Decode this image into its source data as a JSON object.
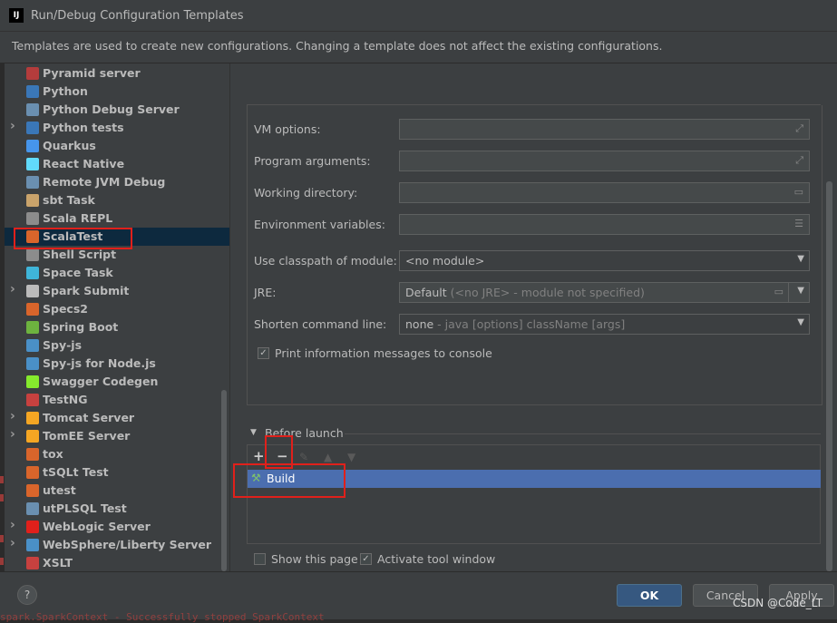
{
  "window": {
    "title": "Run/Debug Configuration Templates",
    "icon_label": "IJ"
  },
  "banner": {
    "text": "Templates are used to create new configurations. Changing a template does not affect the existing configurations."
  },
  "tree": {
    "items": [
      {
        "label": "Pyramid server",
        "icon": "pyramid-icon",
        "color": "#b43c3c",
        "expandable": false,
        "selected": false
      },
      {
        "label": "Python",
        "icon": "python-icon",
        "color": "#3a77b8",
        "expandable": false,
        "selected": false
      },
      {
        "label": "Python Debug Server",
        "icon": "python-debug-icon",
        "color": "#6a8fb0",
        "expandable": false,
        "selected": false
      },
      {
        "label": "Python tests",
        "icon": "python-tests-icon",
        "color": "#3a77b8",
        "expandable": true,
        "selected": false
      },
      {
        "label": "Quarkus",
        "icon": "quarkus-icon",
        "color": "#4695eb",
        "expandable": false,
        "selected": false
      },
      {
        "label": "React Native",
        "icon": "react-icon",
        "color": "#61dafb",
        "expandable": false,
        "selected": false
      },
      {
        "label": "Remote JVM Debug",
        "icon": "remote-debug-icon",
        "color": "#6a8fb0",
        "expandable": false,
        "selected": false
      },
      {
        "label": "sbt Task",
        "icon": "sbt-icon",
        "color": "#c9a36b",
        "expandable": false,
        "selected": false
      },
      {
        "label": "Scala REPL",
        "icon": "scala-repl-icon",
        "color": "#8c8c8c",
        "expandable": false,
        "selected": false
      },
      {
        "label": "ScalaTest",
        "icon": "scalatest-icon",
        "color": "#d9652b",
        "expandable": false,
        "selected": true
      },
      {
        "label": "Shell Script",
        "icon": "shell-script-icon",
        "color": "#8c8c8c",
        "expandable": false,
        "selected": false
      },
      {
        "label": "Space Task",
        "icon": "space-icon",
        "color": "#3fb5d9",
        "expandable": false,
        "selected": false
      },
      {
        "label": "Spark Submit",
        "icon": "spark-icon",
        "color": "#bbbbbb",
        "expandable": true,
        "selected": false
      },
      {
        "label": "Specs2",
        "icon": "specs2-icon",
        "color": "#d9652b",
        "expandable": false,
        "selected": false
      },
      {
        "label": "Spring Boot",
        "icon": "spring-boot-icon",
        "color": "#6db33f",
        "expandable": false,
        "selected": false
      },
      {
        "label": "Spy-js",
        "icon": "spyjs-icon",
        "color": "#4a90c7",
        "expandable": false,
        "selected": false
      },
      {
        "label": "Spy-js for Node.js",
        "icon": "spyjs-node-icon",
        "color": "#4a90c7",
        "expandable": false,
        "selected": false
      },
      {
        "label": "Swagger Codegen",
        "icon": "swagger-icon",
        "color": "#85ea2d",
        "expandable": false,
        "selected": false
      },
      {
        "label": "TestNG",
        "icon": "testng-icon",
        "color": "#c7413f",
        "expandable": false,
        "selected": false
      },
      {
        "label": "Tomcat Server",
        "icon": "tomcat-icon",
        "color": "#f5a623",
        "expandable": true,
        "selected": false
      },
      {
        "label": "TomEE Server",
        "icon": "tomee-icon",
        "color": "#f5a623",
        "expandable": true,
        "selected": false
      },
      {
        "label": "tox",
        "icon": "tox-icon",
        "color": "#d9652b",
        "expandable": false,
        "selected": false
      },
      {
        "label": "tSQLt Test",
        "icon": "tsqlt-icon",
        "color": "#d9652b",
        "expandable": false,
        "selected": false
      },
      {
        "label": "utest",
        "icon": "utest-icon",
        "color": "#d9652b",
        "expandable": false,
        "selected": false
      },
      {
        "label": "utPLSQL Test",
        "icon": "utplsql-icon",
        "color": "#6a8fb0",
        "expandable": false,
        "selected": false
      },
      {
        "label": "WebLogic Server",
        "icon": "weblogic-icon",
        "color": "#e0201b",
        "expandable": true,
        "selected": false
      },
      {
        "label": "WebSphere/Liberty Server",
        "icon": "websphere-icon",
        "color": "#4a90c7",
        "expandable": true,
        "selected": false
      },
      {
        "label": "XSLT",
        "icon": "xslt-icon",
        "color": "#c7413f",
        "expandable": false,
        "selected": false
      }
    ]
  },
  "form": {
    "vm_options": {
      "label": "VM options:",
      "value": ""
    },
    "program_arguments": {
      "label": "Program arguments:",
      "value": ""
    },
    "working_directory": {
      "label": "Working directory:",
      "value": ""
    },
    "environment_variables": {
      "label": "Environment variables:",
      "value": ""
    },
    "classpath_module": {
      "label": "Use classpath of module:",
      "value": "<no module>"
    },
    "jre": {
      "label": "JRE:",
      "value": "Default",
      "hint": "(<no JRE> - module not specified)"
    },
    "shorten_command_line": {
      "label": "Shorten command line:",
      "value": "none",
      "hint": "- java [options] className [args]"
    },
    "print_info": {
      "label": "Print information messages to console",
      "checked": true
    }
  },
  "before_launch": {
    "label": "Before launch",
    "add_symbol": "+",
    "remove_symbol": "−",
    "edit_symbol": "✎",
    "up_symbol": "▲",
    "down_symbol": "▼",
    "tasks": [
      {
        "label": "Build",
        "icon": "build-hammer-icon"
      }
    ]
  },
  "options": {
    "show_this_page": {
      "label": "Show this page",
      "checked": false
    },
    "activate_tool_window": {
      "label": "Activate tool window",
      "checked": true
    }
  },
  "footer": {
    "help_symbol": "?",
    "ok_label": "OK",
    "cancel_label": "Cancel",
    "apply_label": "Apply",
    "watermark": "CSDN @Code_LT"
  },
  "background_text": "spark.SparkContext - Successfully stopped SparkContext"
}
